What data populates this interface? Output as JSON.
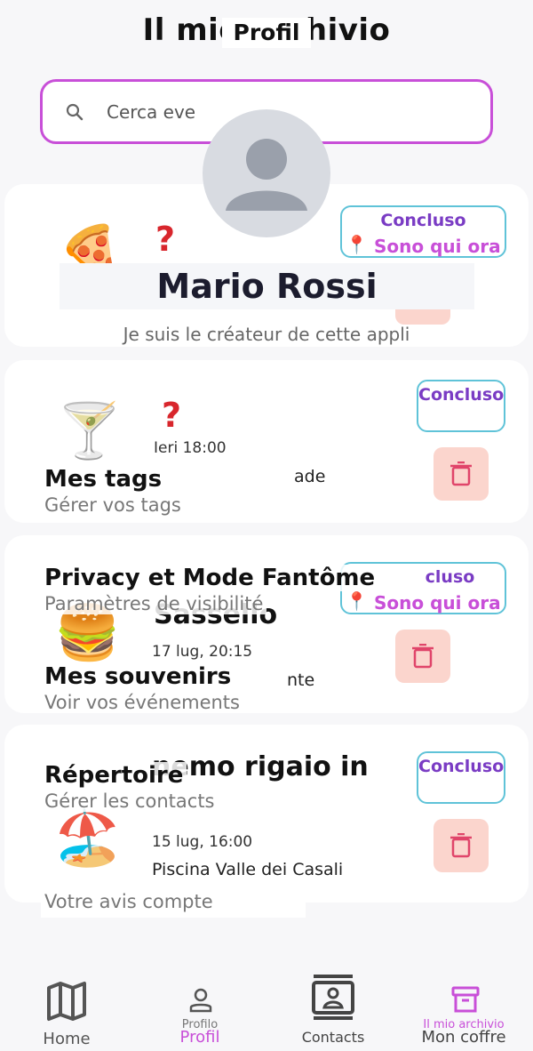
{
  "background": {
    "title": "Il mio archivio",
    "search_placeholder": "Cerca eve",
    "cards": [
      {
        "food": "🍕",
        "badge_status": "Concluso",
        "badge_here": "Sono qui ora"
      },
      {
        "food": "🍸",
        "date": "Ieri 18:00",
        "place": "ade",
        "badge_status": "Concluso"
      },
      {
        "food": "🍔",
        "name": "Sassello",
        "date": "17 lug, 20:15",
        "place": "nte",
        "badge_status": "cluso",
        "badge_here": "Sono qui ora"
      },
      {
        "food": "🏖️",
        "name": "nemo rigaio in",
        "date": "15 lug, 16:00",
        "place": "Piscina Valle dei Casali",
        "badge_status": "Concluso"
      }
    ]
  },
  "profile": {
    "title": "Profil",
    "name": "Mario Rossi",
    "bio": "Je suis le créateur de cette appli",
    "menu": [
      {
        "title": "Mes tags",
        "subtitle": "Gérer vos tags"
      },
      {
        "title": "Privacy et Mode Fantôme",
        "subtitle": "Paramètres de visibilité"
      },
      {
        "title": "Mes souvenirs",
        "subtitle": "Voir vos événements"
      },
      {
        "title": "Répertoire",
        "subtitle": "Gérer les contacts"
      }
    ],
    "feedback": "Votre avis compte"
  },
  "nav": {
    "home": "Home",
    "profil": "Profil",
    "profil_ghost": "Profilo",
    "contacts": "Contacts",
    "coffre": "Mon coffre",
    "coffre_ghost": "Il mio archivio"
  },
  "colors": {
    "accent": "#c84fd8",
    "badge_border": "#5fc3d8",
    "badge_text": "#7a3cc4",
    "trash_bg": "#fbd5cd",
    "trash_icon": "#e0456a"
  }
}
